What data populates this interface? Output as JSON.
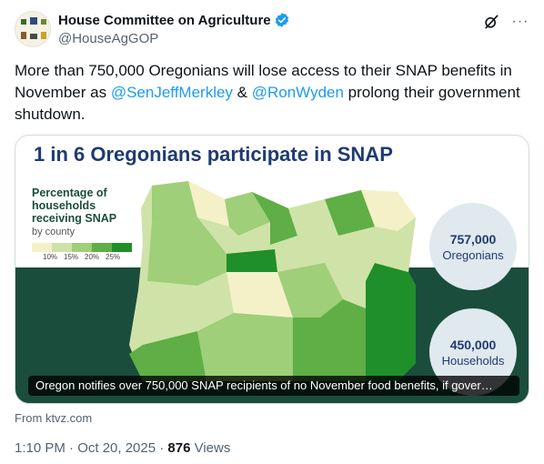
{
  "author": {
    "display_name": "House Committee on Agriculture",
    "handle": "@HouseAgGOP",
    "avatar_icon": "house-ag-avatar-icon",
    "verified_icon": "verified-badge-icon",
    "verified_color": "#1d9bf0"
  },
  "header_actions": {
    "grok_icon": "grok-icon",
    "more_label": "···"
  },
  "tweet": {
    "text_part1": "More than 750,000 Oregonians will lose access to their SNAP benefits in November as ",
    "mention1": "@SenJeffMerkley",
    "text_part2": " & ",
    "mention2": "@RonWyden",
    "text_part3": " prolong their government shutdown."
  },
  "media": {
    "title": "1 in 6 Oregonians participate in SNAP",
    "legend_title": "Percentage of households receiving SNAP",
    "legend_sub": "by county",
    "legend_ticks": [
      "10%",
      "15%",
      "20%",
      "25%"
    ],
    "legend_colors": [
      "#f4f1c8",
      "#cfe3a8",
      "#9fcf78",
      "#5fae46",
      "#1f8f2a"
    ],
    "stat1_number": "757,000",
    "stat1_label": "Oregonians",
    "stat2_number": "450,000",
    "stat2_label": "Households",
    "caption": "Oregon notifies over 750,000 SNAP recipients of no November food benefits, if gover…",
    "accent_title_color": "#1f3b70",
    "band_color": "#1a4d3c"
  },
  "source": "From ktvz.com",
  "meta": {
    "time": "1:10 PM · Oct 20, 2025 · ",
    "views_count": "876",
    "views_label": " Views"
  }
}
